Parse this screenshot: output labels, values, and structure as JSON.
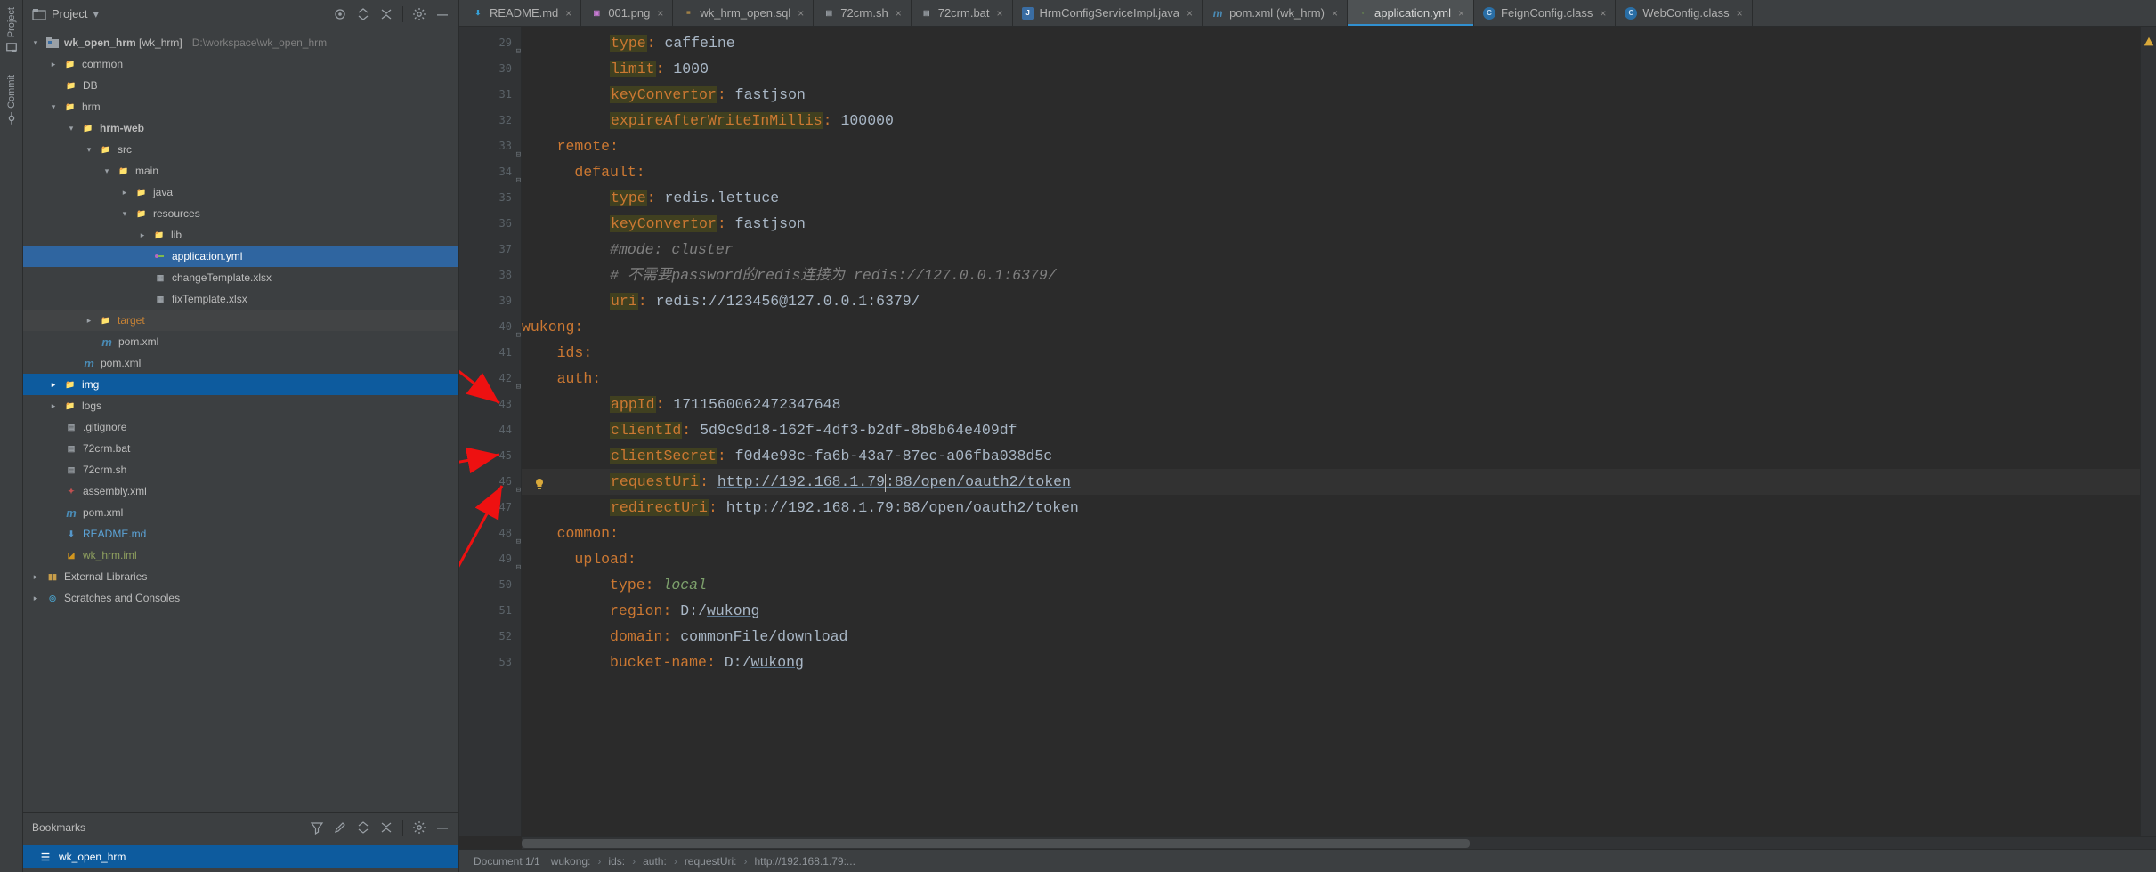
{
  "leftStrip": {
    "project": "Project",
    "commit": "Commit"
  },
  "projectPanel": {
    "title": "Project",
    "root": {
      "label": "wk_open_hrm",
      "tag": "[wk_hrm]",
      "path": "D:\\workspace\\wk_open_hrm"
    },
    "nodes": {
      "common": "common",
      "db": "DB",
      "hrm": "hrm",
      "hrmweb": "hrm-web",
      "src": "src",
      "main": "main",
      "java": "java",
      "resources": "resources",
      "lib": "lib",
      "app_yml": "application.yml",
      "changeTemplate": "changeTemplate.xlsx",
      "fixTemplate": "fixTemplate.xlsx",
      "target": "target",
      "pom1": "pom.xml",
      "pom2": "pom.xml",
      "img": "img",
      "logs": "logs",
      "gitignore": ".gitignore",
      "crmbat": "72crm.bat",
      "crmsh": "72crm.sh",
      "assembly": "assembly.xml",
      "pom3": "pom.xml",
      "readme": "README.md",
      "iml": "wk_hrm.iml",
      "extLib": "External Libraries",
      "scratches": "Scratches and Consoles"
    }
  },
  "bookmarks": {
    "title": "Bookmarks",
    "item": "wk_open_hrm"
  },
  "tabs": [
    {
      "id": "readme",
      "icon": "md",
      "label": "README.md"
    },
    {
      "id": "001png",
      "icon": "png",
      "label": "001.png"
    },
    {
      "id": "wkhrmopen",
      "icon": "sql",
      "label": "wk_hrm_open.sql"
    },
    {
      "id": "72crmsh",
      "icon": "sh",
      "label": "72crm.sh"
    },
    {
      "id": "72crmbat",
      "icon": "bat",
      "label": "72crm.bat"
    },
    {
      "id": "hrmcfg",
      "icon": "java",
      "label": "HrmConfigServiceImpl.java"
    },
    {
      "id": "pomwk",
      "icon": "m",
      "label": "pom.xml (wk_hrm)"
    },
    {
      "id": "appyml",
      "icon": "yml",
      "label": "application.yml",
      "active": true
    },
    {
      "id": "feign",
      "icon": "cls",
      "label": "FeignConfig.class"
    },
    {
      "id": "webcfg",
      "icon": "cls",
      "label": "WebConfig.class"
    }
  ],
  "editor": {
    "first_line_no": 29,
    "lines": [
      {
        "indent": 10,
        "parts": [
          {
            "t": "key",
            "v": "type"
          },
          {
            "t": "colon",
            "v": ": "
          },
          {
            "t": "str",
            "v": "caffeine"
          }
        ]
      },
      {
        "indent": 10,
        "parts": [
          {
            "t": "key",
            "v": "limit"
          },
          {
            "t": "colon",
            "v": ": "
          },
          {
            "t": "num",
            "v": "1000"
          }
        ]
      },
      {
        "indent": 10,
        "parts": [
          {
            "t": "key",
            "v": "keyConvertor"
          },
          {
            "t": "colon",
            "v": ": "
          },
          {
            "t": "str",
            "v": "fastjson"
          }
        ]
      },
      {
        "indent": 10,
        "parts": [
          {
            "t": "key",
            "v": "expireAfterWriteInMillis"
          },
          {
            "t": "colon",
            "v": ": "
          },
          {
            "t": "num",
            "v": "100000"
          }
        ]
      },
      {
        "indent": 4,
        "parts": [
          {
            "t": "keyp",
            "v": "remote"
          },
          {
            "t": "colon",
            "v": ":"
          }
        ]
      },
      {
        "indent": 6,
        "parts": [
          {
            "t": "keyp",
            "v": "default"
          },
          {
            "t": "colon",
            "v": ":"
          }
        ]
      },
      {
        "indent": 10,
        "parts": [
          {
            "t": "key",
            "v": "type"
          },
          {
            "t": "colon",
            "v": ": "
          },
          {
            "t": "str",
            "v": "redis.lettuce"
          }
        ]
      },
      {
        "indent": 10,
        "parts": [
          {
            "t": "key",
            "v": "keyConvertor"
          },
          {
            "t": "colon",
            "v": ": "
          },
          {
            "t": "str",
            "v": "fastjson"
          }
        ]
      },
      {
        "indent": 10,
        "parts": [
          {
            "t": "comment",
            "v": "#mode: cluster"
          }
        ]
      },
      {
        "indent": 10,
        "parts": [
          {
            "t": "comment",
            "v": "# 不需要password的redis连接为 redis://127.0.0.1:6379/"
          }
        ]
      },
      {
        "indent": 10,
        "parts": [
          {
            "t": "key",
            "v": "uri"
          },
          {
            "t": "colon",
            "v": ": "
          },
          {
            "t": "str",
            "v": "redis://123456@127.0.0.1:6379/"
          }
        ]
      },
      {
        "indent": 0,
        "parts": [
          {
            "t": "keyp",
            "v": "wukong"
          },
          {
            "t": "colon",
            "v": ":"
          }
        ]
      },
      {
        "indent": 4,
        "parts": [
          {
            "t": "keyp",
            "v": "ids"
          },
          {
            "t": "colon",
            "v": ":"
          }
        ]
      },
      {
        "indent": 4,
        "parts": [
          {
            "t": "keyp",
            "v": "auth"
          },
          {
            "t": "colon",
            "v": ":"
          }
        ]
      },
      {
        "indent": 10,
        "parts": [
          {
            "t": "key",
            "v": "appId"
          },
          {
            "t": "colon",
            "v": ": "
          },
          {
            "t": "str",
            "v": "1711560062472347648"
          }
        ]
      },
      {
        "indent": 10,
        "parts": [
          {
            "t": "key",
            "v": "clientId"
          },
          {
            "t": "colon",
            "v": ": "
          },
          {
            "t": "str",
            "v": "5d9c9d18-162f-4df3-b2df-8b8b64e409df"
          }
        ]
      },
      {
        "indent": 10,
        "parts": [
          {
            "t": "key",
            "v": "clientSecret"
          },
          {
            "t": "colon",
            "v": ": "
          },
          {
            "t": "str",
            "v": "f0d4e98c-fa6b-43a7-87ec-a06fba038d5c"
          }
        ]
      },
      {
        "indent": 10,
        "caret": true,
        "parts": [
          {
            "t": "key",
            "v": "requestUri"
          },
          {
            "t": "colon",
            "v": ": "
          },
          {
            "t": "url",
            "v": "http://192.168.1.79"
          },
          {
            "t": "caret"
          },
          {
            "t": "url",
            "v": ":88/open/oauth2/token"
          }
        ]
      },
      {
        "indent": 10,
        "parts": [
          {
            "t": "key",
            "v": "redirectUri"
          },
          {
            "t": "colon",
            "v": ": "
          },
          {
            "t": "url",
            "v": "http://192.168.1.79:88/open/oauth2/token"
          }
        ]
      },
      {
        "indent": 4,
        "parts": [
          {
            "t": "keyp",
            "v": "common"
          },
          {
            "t": "colon",
            "v": ":"
          }
        ]
      },
      {
        "indent": 6,
        "parts": [
          {
            "t": "keyp",
            "v": "upload"
          },
          {
            "t": "colon",
            "v": ":"
          }
        ]
      },
      {
        "indent": 10,
        "parts": [
          {
            "t": "keyp",
            "v": "type"
          },
          {
            "t": "colon",
            "v": ": "
          },
          {
            "t": "local",
            "v": "local"
          }
        ]
      },
      {
        "indent": 10,
        "parts": [
          {
            "t": "keyp",
            "v": "region"
          },
          {
            "t": "colon",
            "v": ": "
          },
          {
            "t": "str",
            "v": "D:/"
          },
          {
            "t": "url",
            "v": "wukong"
          }
        ]
      },
      {
        "indent": 10,
        "parts": [
          {
            "t": "keyp",
            "v": "domain"
          },
          {
            "t": "colon",
            "v": ": "
          },
          {
            "t": "str",
            "v": "commonFile/download"
          }
        ]
      },
      {
        "indent": 10,
        "parts": [
          {
            "t": "keyp",
            "v": "bucket-name"
          },
          {
            "t": "colon",
            "v": ": "
          },
          {
            "t": "str",
            "v": "D:/"
          },
          {
            "t": "url",
            "v": "wukong"
          }
        ]
      }
    ],
    "fold_marks_at": [
      29,
      33,
      34,
      40,
      42,
      46,
      48,
      49
    ],
    "hint_bulb_line": 46
  },
  "warnings": {
    "count": "1"
  },
  "status": {
    "doc": "Document 1/1",
    "crumbs": [
      "wukong:",
      "ids:",
      "auth:",
      "requestUri:",
      "http://192.168.1.79:..."
    ]
  }
}
